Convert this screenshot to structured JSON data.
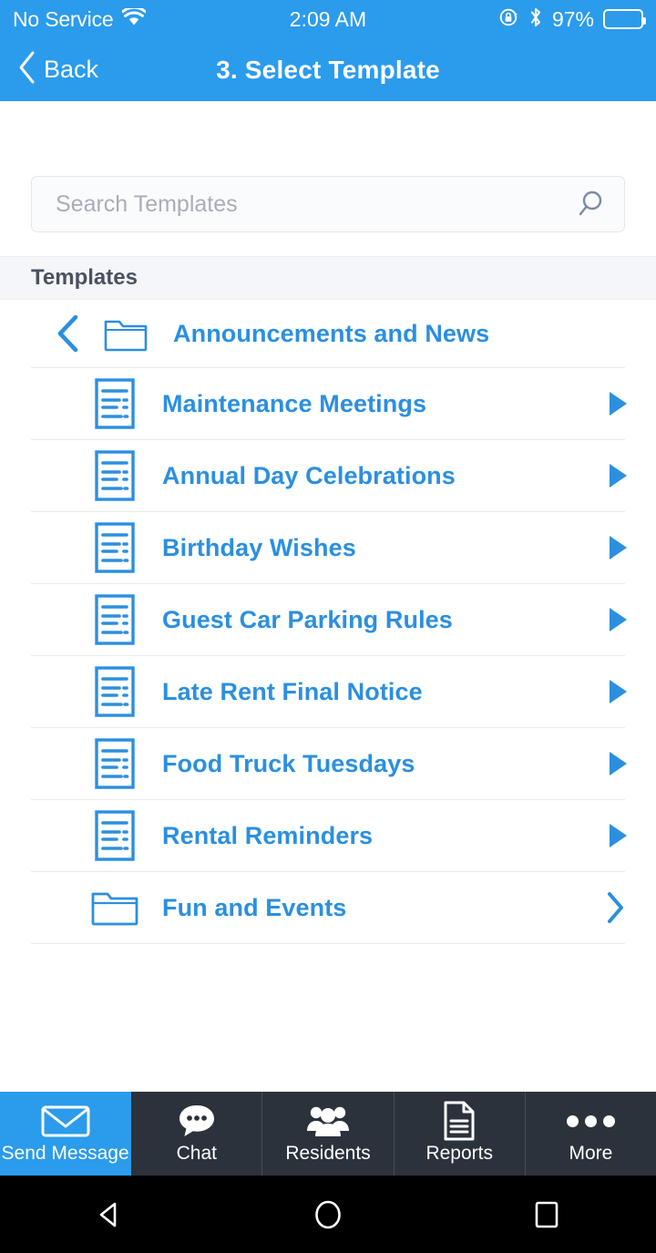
{
  "status_bar": {
    "carrier": "No Service",
    "wifi_icon": "wifi-icon",
    "time": "2:09 AM",
    "rotation_lock_icon": "rotation-lock-icon",
    "bluetooth_icon": "bluetooth-icon",
    "battery_percent": "97%",
    "battery_level": 97
  },
  "nav_header": {
    "back_label": "Back",
    "back_icon": "chevron-left-icon",
    "title": "3. Select Template"
  },
  "search": {
    "placeholder": "Search Templates",
    "value": "",
    "icon": "search-icon"
  },
  "section": {
    "title": "Templates"
  },
  "parent_folder": {
    "label": "Announcements and News",
    "back_icon": "chevron-left-icon",
    "folder_icon": "folder-icon"
  },
  "list_items": [
    {
      "label": "Maintenance Meetings",
      "type": "document",
      "icon": "document-icon",
      "arrow": "triangle-right-icon"
    },
    {
      "label": "Annual Day Celebrations",
      "type": "document",
      "icon": "document-icon",
      "arrow": "triangle-right-icon"
    },
    {
      "label": "Birthday Wishes",
      "type": "document",
      "icon": "document-icon",
      "arrow": "triangle-right-icon"
    },
    {
      "label": "Guest Car Parking Rules",
      "type": "document",
      "icon": "document-icon",
      "arrow": "triangle-right-icon"
    },
    {
      "label": "Late Rent Final Notice",
      "type": "document",
      "icon": "document-icon",
      "arrow": "triangle-right-icon"
    },
    {
      "label": "Food Truck Tuesdays",
      "type": "document",
      "icon": "document-icon",
      "arrow": "triangle-right-icon"
    },
    {
      "label": "Rental Reminders",
      "type": "document",
      "icon": "document-icon",
      "arrow": "triangle-right-icon"
    },
    {
      "label": "Fun and Events",
      "type": "folder",
      "icon": "folder-icon",
      "arrow": "chevron-right-icon"
    }
  ],
  "tab_bar": [
    {
      "label": "Send Message",
      "icon": "envelope-icon",
      "active": true
    },
    {
      "label": "Chat",
      "icon": "chat-bubble-icon",
      "active": false
    },
    {
      "label": "Residents",
      "icon": "people-icon",
      "active": false
    },
    {
      "label": "Reports",
      "icon": "document-page-icon",
      "active": false
    },
    {
      "label": "More",
      "icon": "ellipsis-icon",
      "active": false
    }
  ],
  "android_nav": {
    "back": "android-back-icon",
    "home": "android-home-icon",
    "recents": "android-recents-icon"
  },
  "colors": {
    "header_blue": "#2B9BEC",
    "link_blue": "#2B8FE0",
    "tab_dark": "#2B323C",
    "section_bg": "#F5F6FA",
    "separator": "#E9E9E9"
  }
}
